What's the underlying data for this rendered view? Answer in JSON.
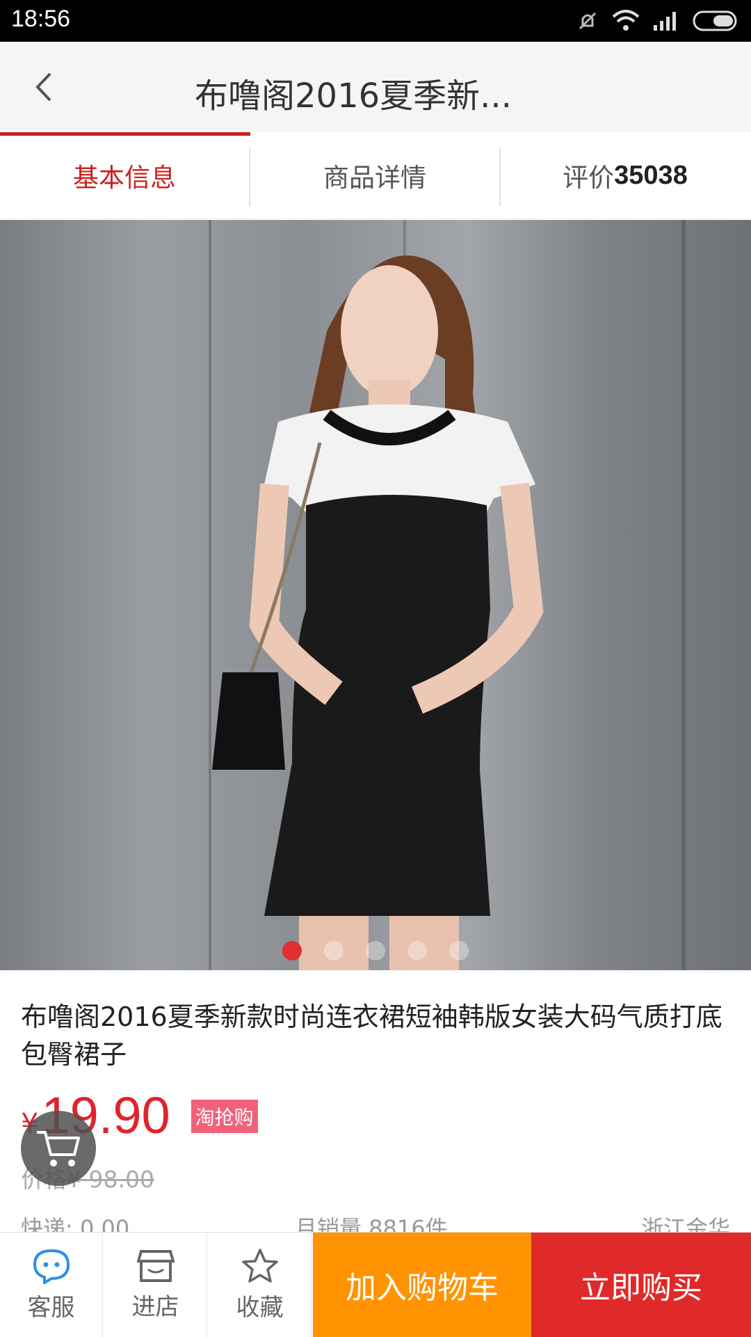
{
  "status_bar": {
    "time": "18:56"
  },
  "header": {
    "title": "布噜阁2016夏季新..."
  },
  "tabs": [
    {
      "label": "基本信息"
    },
    {
      "label": "商品详情"
    },
    {
      "label": "评价",
      "count": "35038"
    }
  ],
  "gallery": {
    "total_images": 5,
    "active_index": 0
  },
  "product": {
    "title": "布噜阁2016夏季新款时尚连衣裙短袖韩版女装大码气质打底包臀裙子",
    "currency": "¥",
    "price": "19.90",
    "promo_badge": "淘抢购",
    "original_price_label": "价格",
    "original_price": "¥ 98.00",
    "shipping": "快递: 0.00",
    "monthly_sales": "月销量 8816件",
    "location": "浙江金华"
  },
  "bottom_bar": {
    "service": "客服",
    "shop": "进店",
    "favorite": "收藏",
    "add_to_cart": "加入购物车",
    "buy_now": "立即购买"
  },
  "colors": {
    "accent": "#cc1f1f",
    "price": "#e0232b",
    "add_to_cart": "#ff9302",
    "buy_now": "#e02a2a",
    "promo_badge": "#f2607a"
  },
  "icons": [
    "back-arrow-icon",
    "mute-icon",
    "wifi-icon",
    "signal-icon",
    "battery-icon",
    "cart-icon",
    "chat-bubble-icon",
    "store-icon",
    "star-icon"
  ]
}
